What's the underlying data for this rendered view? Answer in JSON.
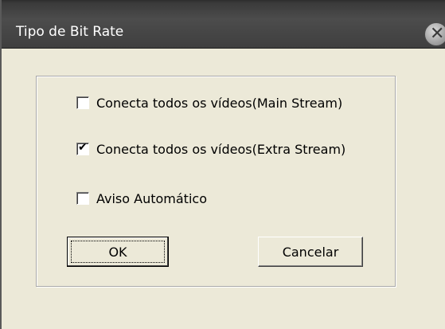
{
  "window": {
    "title": "Tipo de Bit Rate",
    "close_glyph": "✕"
  },
  "options": [
    {
      "label": "Conecta todos os vídeos(Main Stream)",
      "checked": false
    },
    {
      "label": "Conecta todos os vídeos(Extra Stream)",
      "checked": true
    },
    {
      "label": "Aviso Automático",
      "checked": false
    }
  ],
  "buttons": {
    "ok_label": "OK",
    "cancel_label": "Cancelar"
  },
  "check_glyph": "✔"
}
